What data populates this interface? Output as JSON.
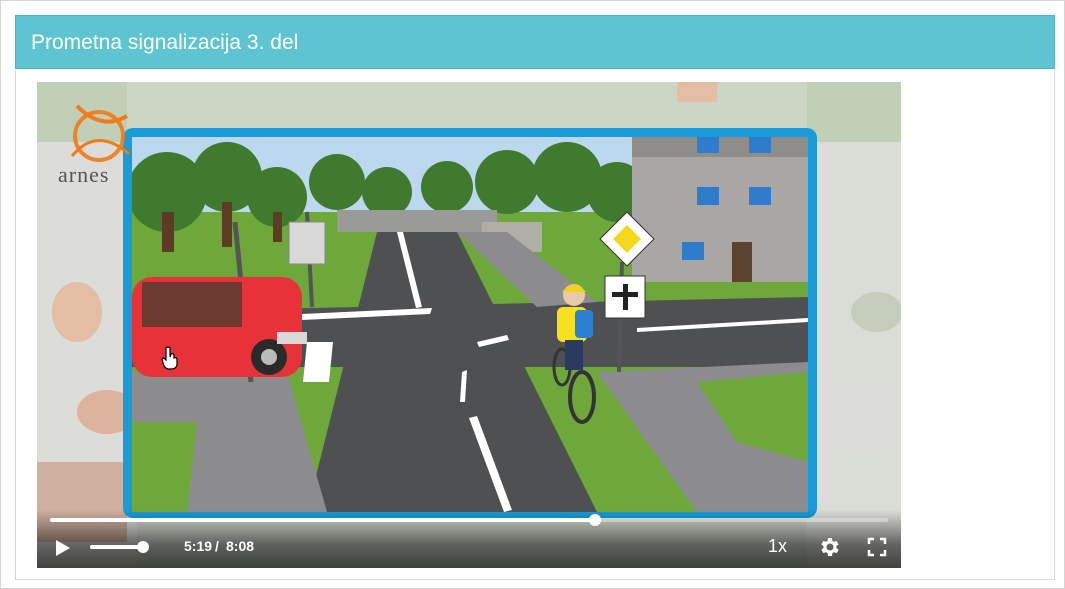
{
  "page": {
    "title": "Prometna signalizacija 3. del"
  },
  "video": {
    "logo_text": "arnes",
    "progress_fraction": 0.65,
    "volume_fraction": 0.95,
    "current_time": "5:19",
    "separator": "/",
    "duration": "8:08",
    "speed": "1x",
    "icons": {
      "play": "play-icon",
      "settings": "gear-icon",
      "fullscreen": "fullscreen-icon",
      "cursor": "hand-cursor-icon"
    }
  },
  "colors": {
    "header_bg": "#5fc4d1",
    "frame_blue": "#1a9ad6",
    "car_red": "#e8323a",
    "sign_yellow": "#f4d81e"
  }
}
